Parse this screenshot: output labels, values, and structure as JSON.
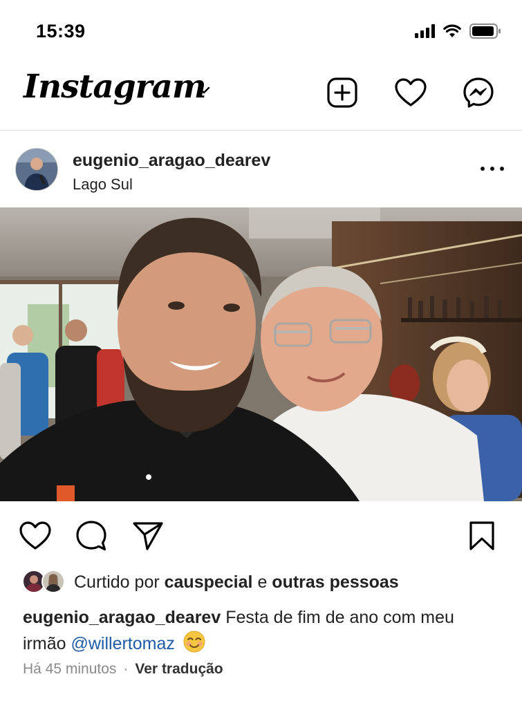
{
  "status_bar": {
    "time": "15:39"
  },
  "header": {
    "logo_text": "Instagram",
    "icons": [
      "plus-square-icon",
      "heart-icon",
      "messenger-icon"
    ]
  },
  "post": {
    "username": "eugenio_aragao_dearev",
    "location": "Lago Sul",
    "likes": {
      "prefix": "Curtido por",
      "liked_by": "causpecial",
      "conjunction": "e",
      "others": "outras pessoas"
    },
    "caption": {
      "username": "eugenio_aragao_dearev",
      "text": "Festa de fim de ano com meu irmão",
      "mention": "@willertomaz"
    },
    "time_ago": "Há 45 minutos",
    "separator": "·",
    "translate_label": "Ver tradução"
  },
  "colors": {
    "mention": "#1f5aa6",
    "meta_text": "#8a8a8a",
    "divider": "#dcdcdc"
  }
}
